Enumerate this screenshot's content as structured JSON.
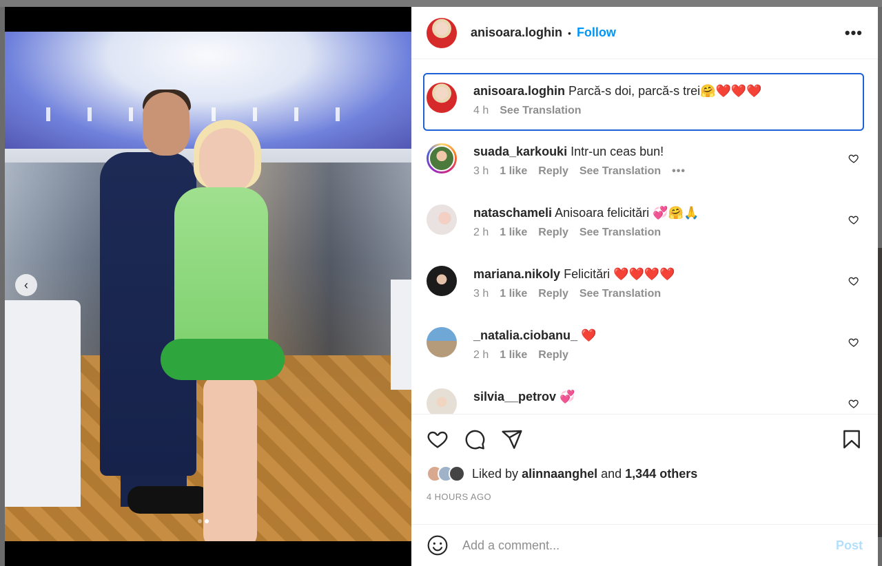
{
  "post": {
    "author": "anisoara.loghin",
    "separator": "•",
    "follow_label": "Follow",
    "more_label": "•••"
  },
  "caption": {
    "user": "anisoara.loghin",
    "text": "Parcă-s doi, parcă-s trei🤗❤️❤️❤️",
    "time": "4 h",
    "see_translation": "See Translation"
  },
  "comments": [
    {
      "user": "suada_karkouki",
      "text": "Intr-un ceas bun!",
      "time": "3 h",
      "likes": "1 like",
      "reply": "Reply",
      "translation": "See Translation",
      "more": "•••"
    },
    {
      "user": "nataschameli",
      "text": "Anisoara felicitări 💞🤗🙏",
      "time": "2 h",
      "likes": "1 like",
      "reply": "Reply",
      "translation": "See Translation"
    },
    {
      "user": "mariana.nikoly",
      "text": "Felicitări ❤️❤️❤️❤️",
      "time": "3 h",
      "likes": "1 like",
      "reply": "Reply",
      "translation": "See Translation"
    },
    {
      "user": "_natalia.ciobanu_",
      "text": "❤️",
      "time": "2 h",
      "likes": "1 like",
      "reply": "Reply"
    },
    {
      "user": "silvia__petrov",
      "text": "💞"
    }
  ],
  "likes": {
    "prefix": "Liked by",
    "first_user": "alinnaanghel",
    "conjunction": "and",
    "others": "1,344 others"
  },
  "timestamp": "4 HOURS AGO",
  "add_comment": {
    "placeholder": "Add a comment...",
    "post_label": "Post"
  },
  "carousel": {
    "prev_icon": "chevron-left-icon",
    "slide_count": 2,
    "active_slide": 2
  },
  "colors": {
    "accent": "#0095f6",
    "caption_focus_border": "#1e5fd6",
    "post_disabled": "#b2dffc"
  }
}
